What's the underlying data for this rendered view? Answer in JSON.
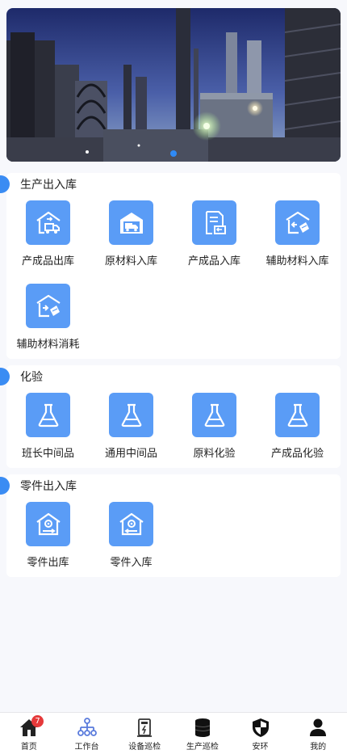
{
  "banner": {
    "slides": 1,
    "active_slide": 1
  },
  "sections": [
    {
      "title": "生产出入库",
      "items": [
        {
          "label": "产成品出库",
          "icon": "warehouse-truck-out-icon"
        },
        {
          "label": "原材料入库",
          "icon": "warehouse-truck-in-icon"
        },
        {
          "label": "产成品入库",
          "icon": "document-return-icon"
        },
        {
          "label": "辅助材料入库",
          "icon": "warehouse-box-in-icon"
        },
        {
          "label": "辅助材料消耗",
          "icon": "warehouse-box-consume-icon"
        }
      ]
    },
    {
      "title": "化验",
      "items": [
        {
          "label": "班长中间品",
          "icon": "flask-icon"
        },
        {
          "label": "通用中间品",
          "icon": "flask-icon"
        },
        {
          "label": "原料化验",
          "icon": "flask-icon"
        },
        {
          "label": "产成品化验",
          "icon": "flask-icon"
        }
      ]
    },
    {
      "title": "零件出入库",
      "items": [
        {
          "label": "零件出库",
          "icon": "parts-out-icon"
        },
        {
          "label": "零件入库",
          "icon": "parts-in-icon"
        }
      ]
    }
  ],
  "tabbar": {
    "tabs": [
      {
        "label": "首页",
        "icon": "home-icon"
      },
      {
        "label": "工作台",
        "icon": "org-chart-icon"
      },
      {
        "label": "设备巡检",
        "icon": "power-device-icon"
      },
      {
        "label": "生产巡检",
        "icon": "tank-icon"
      },
      {
        "label": "安环",
        "icon": "shield-icon"
      },
      {
        "label": "我的",
        "icon": "user-icon"
      }
    ],
    "home_badge": "7",
    "active_tab": "首页"
  },
  "colors": {
    "accent": "#3a8cf3",
    "tile": "#5a9cf6",
    "badge": "#e5393a",
    "background": "#f7f8fc"
  }
}
